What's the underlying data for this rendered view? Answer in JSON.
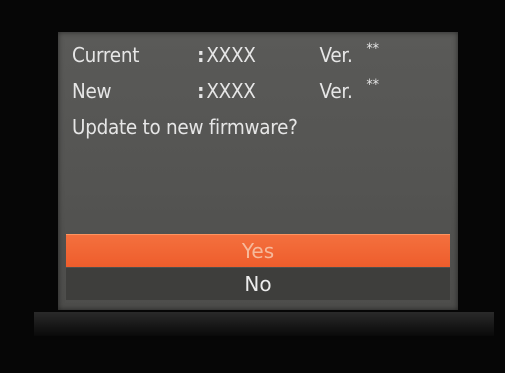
{
  "dialog": {
    "current": {
      "label": "Current",
      "colon": ":",
      "value": "XXXX",
      "ver_label": "Ver.",
      "ver_value": "**"
    },
    "new": {
      "label": "New",
      "colon": ":",
      "value": "XXXX",
      "ver_label": "Ver.",
      "ver_value": "**"
    },
    "question": "Update to new firmware?",
    "options": [
      {
        "label": "Yes",
        "selected": true
      },
      {
        "label": "No",
        "selected": false
      }
    ]
  },
  "colors": {
    "highlight": "#ee5d2c",
    "screen_bg": "#565654",
    "option_bg": "#3e3e3c"
  }
}
